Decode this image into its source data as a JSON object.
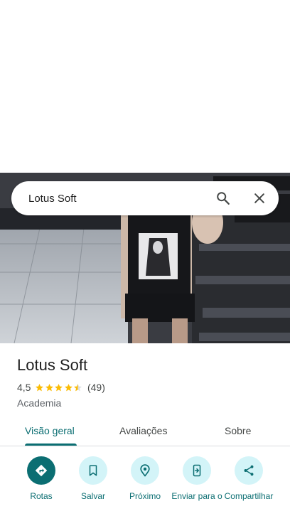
{
  "search": {
    "query": "Lotus Soft"
  },
  "place": {
    "name": "Lotus Soft",
    "rating": "4,5",
    "stars_filled": 4.5,
    "review_count": "(49)",
    "category": "Academia"
  },
  "tabs": [
    {
      "label": "Visão geral",
      "active": true
    },
    {
      "label": "Avaliações",
      "active": false
    },
    {
      "label": "Sobre",
      "active": false
    }
  ],
  "actions": [
    {
      "label": "Rotas",
      "icon": "directions-icon"
    },
    {
      "label": "Salvar",
      "icon": "bookmark-icon"
    },
    {
      "label": "Próximo",
      "icon": "nearby-icon"
    },
    {
      "label": "Enviar para o",
      "icon": "send-to-phone-icon"
    },
    {
      "label": "Compartilhar",
      "icon": "share-icon"
    }
  ],
  "colors": {
    "accent": "#0b6e72",
    "action_bg": "#d3f4f8",
    "star": "#fbbc04"
  }
}
